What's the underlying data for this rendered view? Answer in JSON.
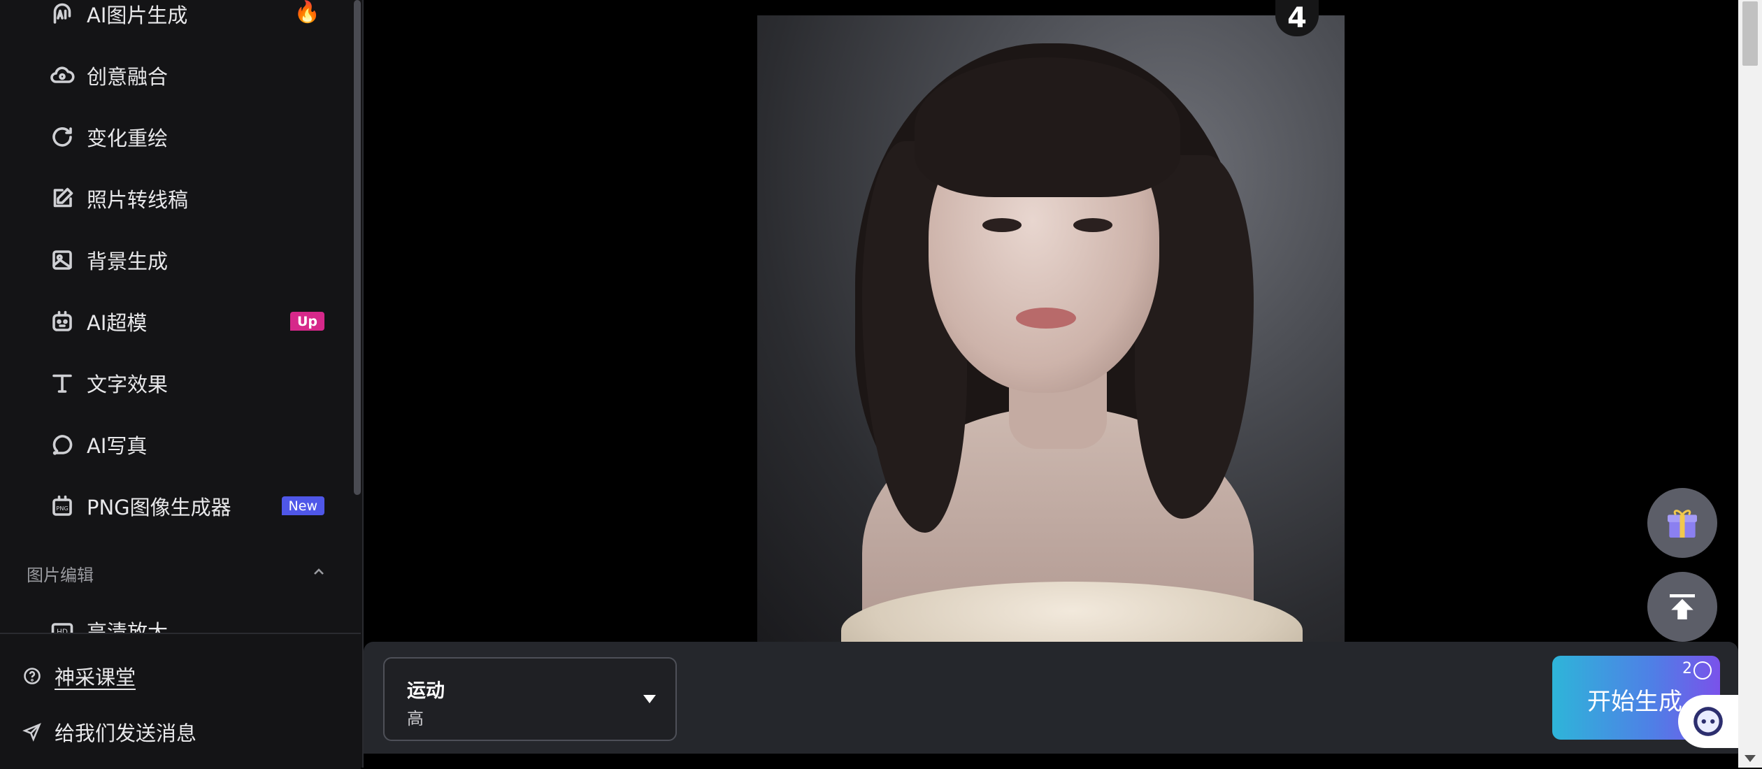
{
  "sidebar": {
    "items": [
      {
        "label": "AI图片生成",
        "icon": "ai-image-icon",
        "badge_icon": "fire-icon"
      },
      {
        "label": "创意融合",
        "icon": "cloud-blend-icon"
      },
      {
        "label": "变化重绘",
        "icon": "refresh-icon"
      },
      {
        "label": "照片转线稿",
        "icon": "edit-icon"
      },
      {
        "label": "背景生成",
        "icon": "image-icon"
      },
      {
        "label": "AI超模",
        "icon": "robot-icon",
        "badge": "Up"
      },
      {
        "label": "文字效果",
        "icon": "text-icon"
      },
      {
        "label": "AI写真",
        "icon": "face-icon"
      },
      {
        "label": "PNG图像生成器",
        "icon": "png-icon",
        "badge": "New"
      },
      {
        "label": "高清放大",
        "icon": "hd-icon"
      }
    ],
    "section_title": "图片编辑",
    "bottom_links": [
      {
        "label": "神采课堂",
        "icon": "help-icon"
      },
      {
        "label": "给我们发送消息",
        "icon": "send-icon"
      }
    ]
  },
  "image": {
    "corner_badge": "4"
  },
  "bottom_bar": {
    "select": {
      "title": "运动",
      "value": "高"
    },
    "generate": {
      "label": "开始生成",
      "count": "2"
    }
  }
}
